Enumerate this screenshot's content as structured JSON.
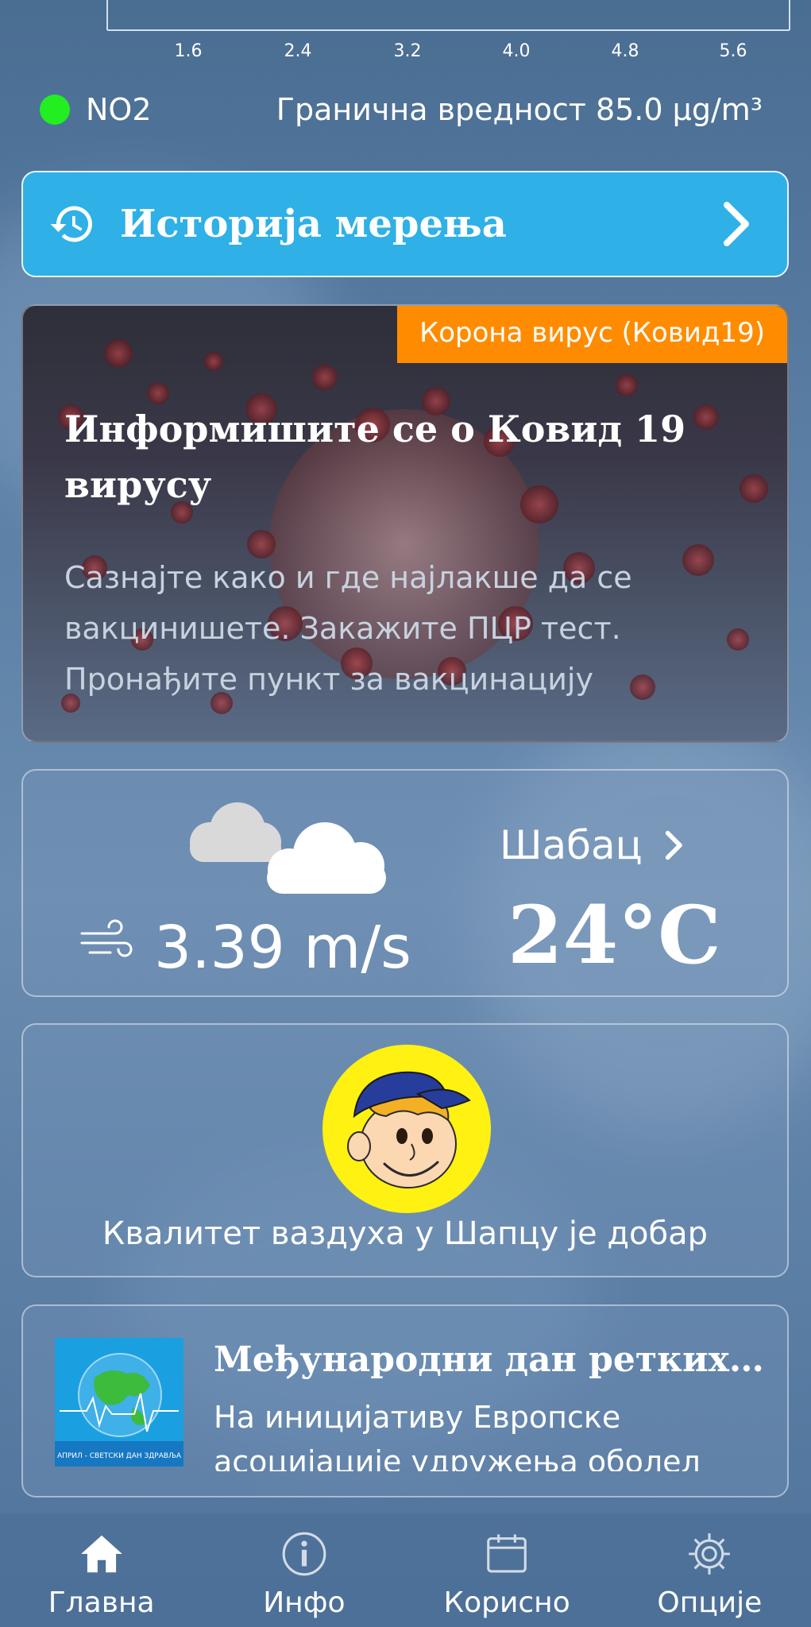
{
  "axis_fragment": {
    "ticks": [
      "1.6",
      "2.4",
      "3.2",
      "4.0",
      "4.8",
      "5.6"
    ]
  },
  "pollutant": {
    "name": "NO2",
    "status_color": "#22ee22",
    "limit_text": "Гранична вредност 85.0 µg/m³"
  },
  "history_button": {
    "label": "Историја мерења",
    "icon": "history-icon"
  },
  "covid_card": {
    "badge": "Корона вирус (Ковид19)",
    "title": "Информишите се о Ковид 19 вирусу",
    "description": "Сазнајте како и где најлакше да се вакцинишете. Закажите ПЦР тест. Пронађите пункт за вакцинацију",
    "badge_color": "#ff8c00"
  },
  "weather": {
    "icon": "cloud-icon",
    "wind_icon": "wind-icon",
    "wind_speed": "3.39 m/s",
    "city": "Шабац",
    "temperature": "24°C"
  },
  "air_quality": {
    "mascot": "smiling-boy-mascot",
    "message": "Квалитет ваздуха у Шапцу је добар"
  },
  "news": {
    "title": "Међународни дан ретких…",
    "body": "На иницијативу Европске асоцијације удружења оболел",
    "thumb_caption": "АПРИЛ - СВЕТСКИ ДАН ЗДРАВЉА"
  },
  "nav": [
    {
      "label": "Главна",
      "icon": "home-icon",
      "active": true
    },
    {
      "label": "Инфо",
      "icon": "info-icon",
      "active": false
    },
    {
      "label": "Корисно",
      "icon": "calendar-icon",
      "active": false
    },
    {
      "label": "Опције",
      "icon": "gear-icon",
      "active": false
    }
  ]
}
